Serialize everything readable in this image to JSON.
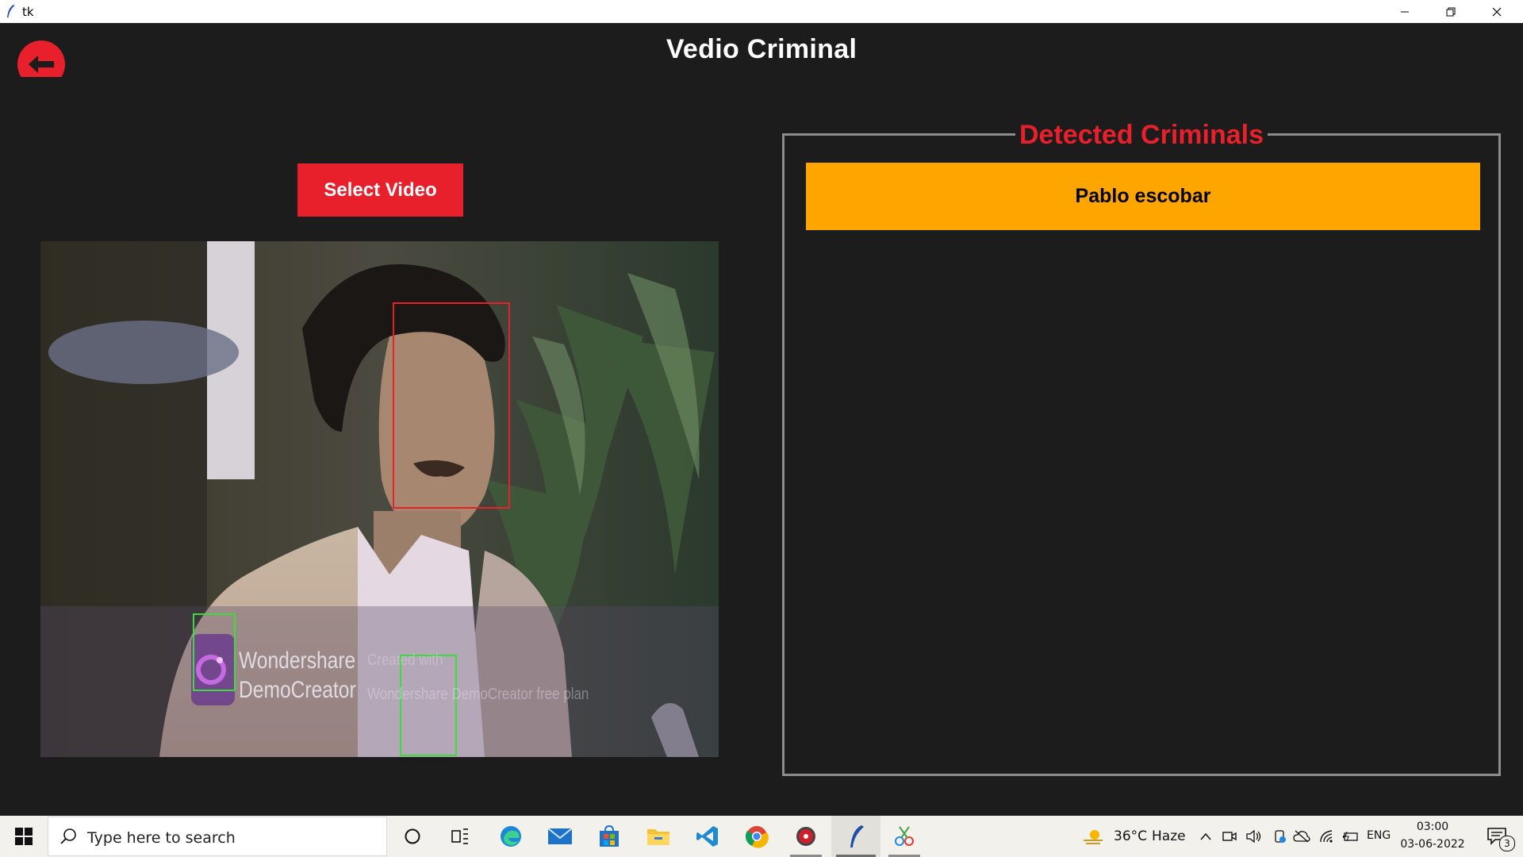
{
  "window": {
    "title": "tk"
  },
  "app": {
    "title": "Vedio Criminal",
    "select_button": "Select Video",
    "panel_title": "Detected Criminals",
    "detected": [
      "Pablo escobar"
    ],
    "video_watermark": {
      "brand_line1": "Wondershare",
      "brand_line2": "DemoCreator",
      "created_with": "Created with",
      "free_plan": "Wondershare DemoCreator free plan"
    }
  },
  "taskbar": {
    "search_placeholder": "Type here to search",
    "weather": {
      "temp": "36°C",
      "condition": "Haze"
    },
    "language": "ENG",
    "time": "03:00",
    "date": "03-06-2022",
    "notification_count": "3"
  },
  "colors": {
    "accent_red": "#e8202b",
    "detected_bg": "#ffa500",
    "app_bg": "#1c1c1c",
    "face_box_match": "#e8202b",
    "face_box_other": "#3cdc3c"
  }
}
